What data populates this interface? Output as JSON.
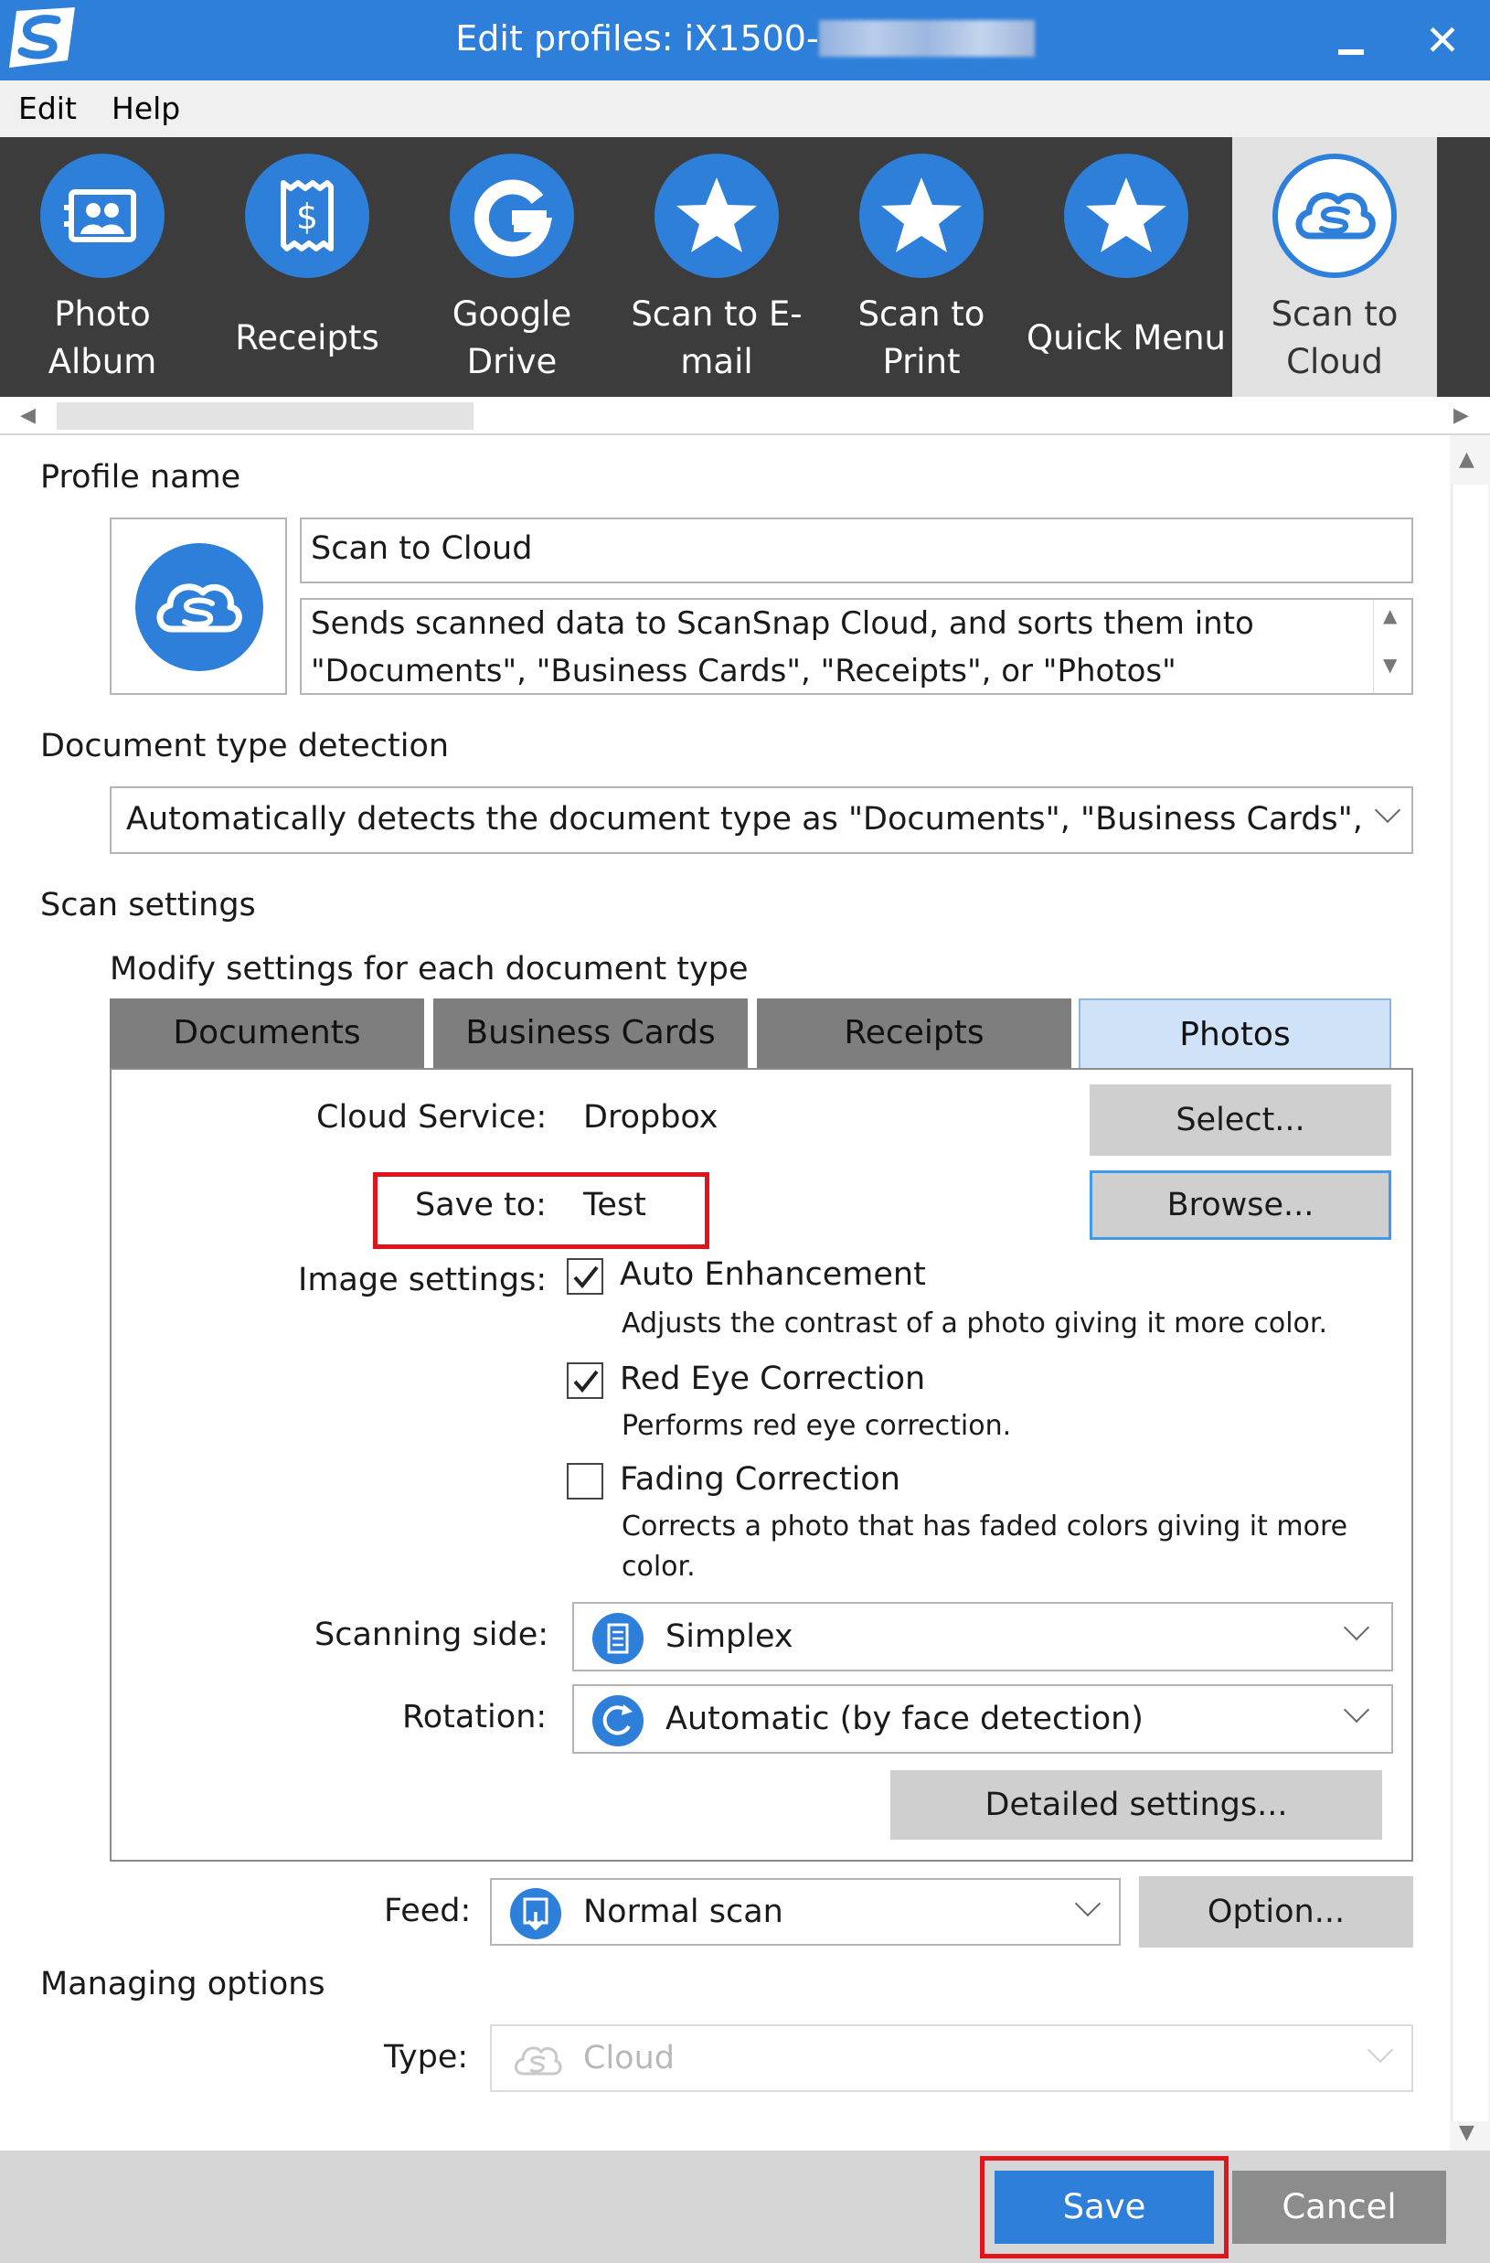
{
  "window": {
    "title": "Edit profiles: iX1500-",
    "close_glyph": "✕"
  },
  "menu": {
    "items": [
      "Edit",
      "Help"
    ]
  },
  "profiles": [
    {
      "line1": "Photo",
      "line2": "Album",
      "icon": "photo-album-icon"
    },
    {
      "line1": "Receipts",
      "line2": "",
      "icon": "receipt-icon"
    },
    {
      "line1": "Google",
      "line2": "Drive",
      "icon": "google-icon"
    },
    {
      "line1": "Scan to E-",
      "line2": "mail",
      "icon": "star-icon"
    },
    {
      "line1": "Scan to",
      "line2": "Print",
      "icon": "star-icon"
    },
    {
      "line1": "Quick Menu",
      "line2": "",
      "icon": "star-icon"
    },
    {
      "line1": "Scan to",
      "line2": "Cloud",
      "icon": "cloud-icon",
      "selected": true
    }
  ],
  "profile_name": {
    "label": "Profile name",
    "name_value": "Scan to Cloud",
    "description_line1": "Sends scanned data to ScanSnap Cloud, and sorts them into",
    "description_line2": "\"Documents\", \"Business Cards\", \"Receipts\", or \"Photos\""
  },
  "doc_type": {
    "label": "Document type detection",
    "value": "Automatically detects the document type as \"Documents\", \"Business Cards\", '"
  },
  "scan_settings": {
    "label": "Scan settings",
    "sublabel": "Modify settings for each document type",
    "tabs": [
      "Documents",
      "Business Cards",
      "Receipts",
      "Photos"
    ],
    "active_tab": "Photos",
    "cloud_service_label": "Cloud Service:",
    "cloud_service_value": "Dropbox",
    "select_button": "Select...",
    "save_to_label": "Save to:",
    "save_to_value": "Test",
    "browse_button": "Browse...",
    "image_settings_label": "Image settings:",
    "options": [
      {
        "label": "Auto Enhancement",
        "checked": true,
        "desc1": "Adjusts the contrast of a photo giving it more color.",
        "desc2": ""
      },
      {
        "label": "Red Eye Correction",
        "checked": true,
        "desc1": "Performs red eye correction.",
        "desc2": ""
      },
      {
        "label": "Fading Correction",
        "checked": false,
        "desc1": "Corrects a photo that has faded colors giving it more",
        "desc2": "color."
      }
    ],
    "scanning_side_label": "Scanning side:",
    "scanning_side_value": "Simplex",
    "rotation_label": "Rotation:",
    "rotation_value": "Automatic (by face detection)",
    "detailed_button": "Detailed settings..."
  },
  "feed": {
    "label": "Feed:",
    "value": "Normal scan",
    "option_button": "Option..."
  },
  "managing": {
    "label": "Managing options",
    "type_label": "Type:",
    "type_value": "Cloud"
  },
  "footer": {
    "save": "Save",
    "cancel": "Cancel"
  },
  "colors": {
    "accent": "#2d7fd9",
    "highlight": "#e0141b",
    "strip": "#3c3c3c"
  }
}
